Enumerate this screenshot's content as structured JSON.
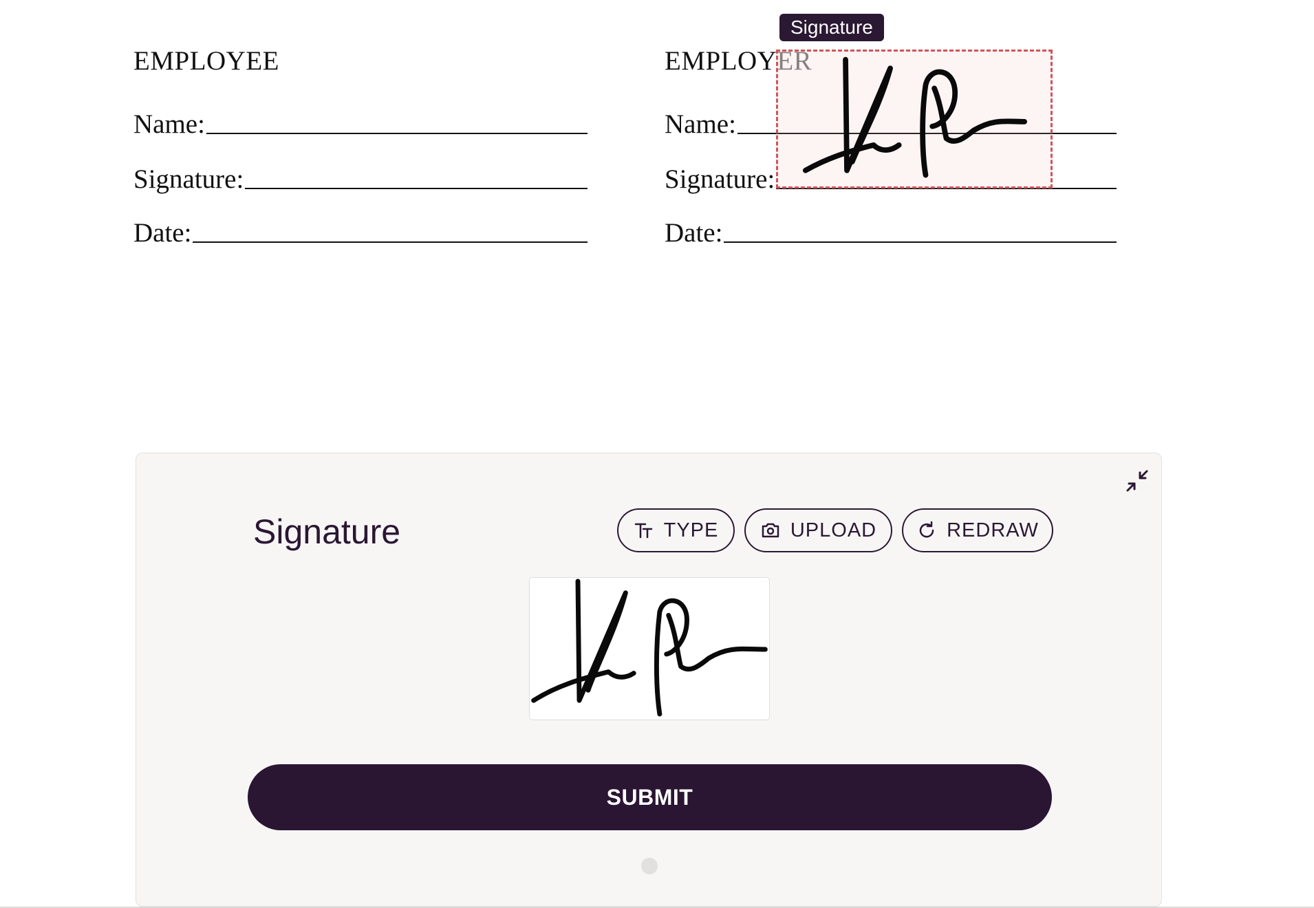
{
  "document": {
    "employee": {
      "heading": "EMPLOYEE",
      "name_label": "Name:",
      "signature_label": "Signature:",
      "date_label": "Date:"
    },
    "employer": {
      "heading_part1": "EMPLOY",
      "heading_part2": "ER",
      "name_label": "Name:",
      "signature_label": "Signature:",
      "date_label": "Date:"
    },
    "signature_field_tooltip": "Signature"
  },
  "signature_panel": {
    "title": "Signature",
    "buttons": {
      "type_label": "TYPE",
      "upload_label": "UPLOAD",
      "redraw_label": "REDRAW"
    },
    "submit_label": "SUBMIT"
  },
  "icons": {
    "collapse": "collapse-arrows-icon",
    "type": "text-size-icon",
    "upload": "camera-icon",
    "redraw": "refresh-icon"
  },
  "colors": {
    "primary": "#2a1533",
    "field_border": "#d0545a",
    "panel_bg": "#f7f6f5"
  }
}
